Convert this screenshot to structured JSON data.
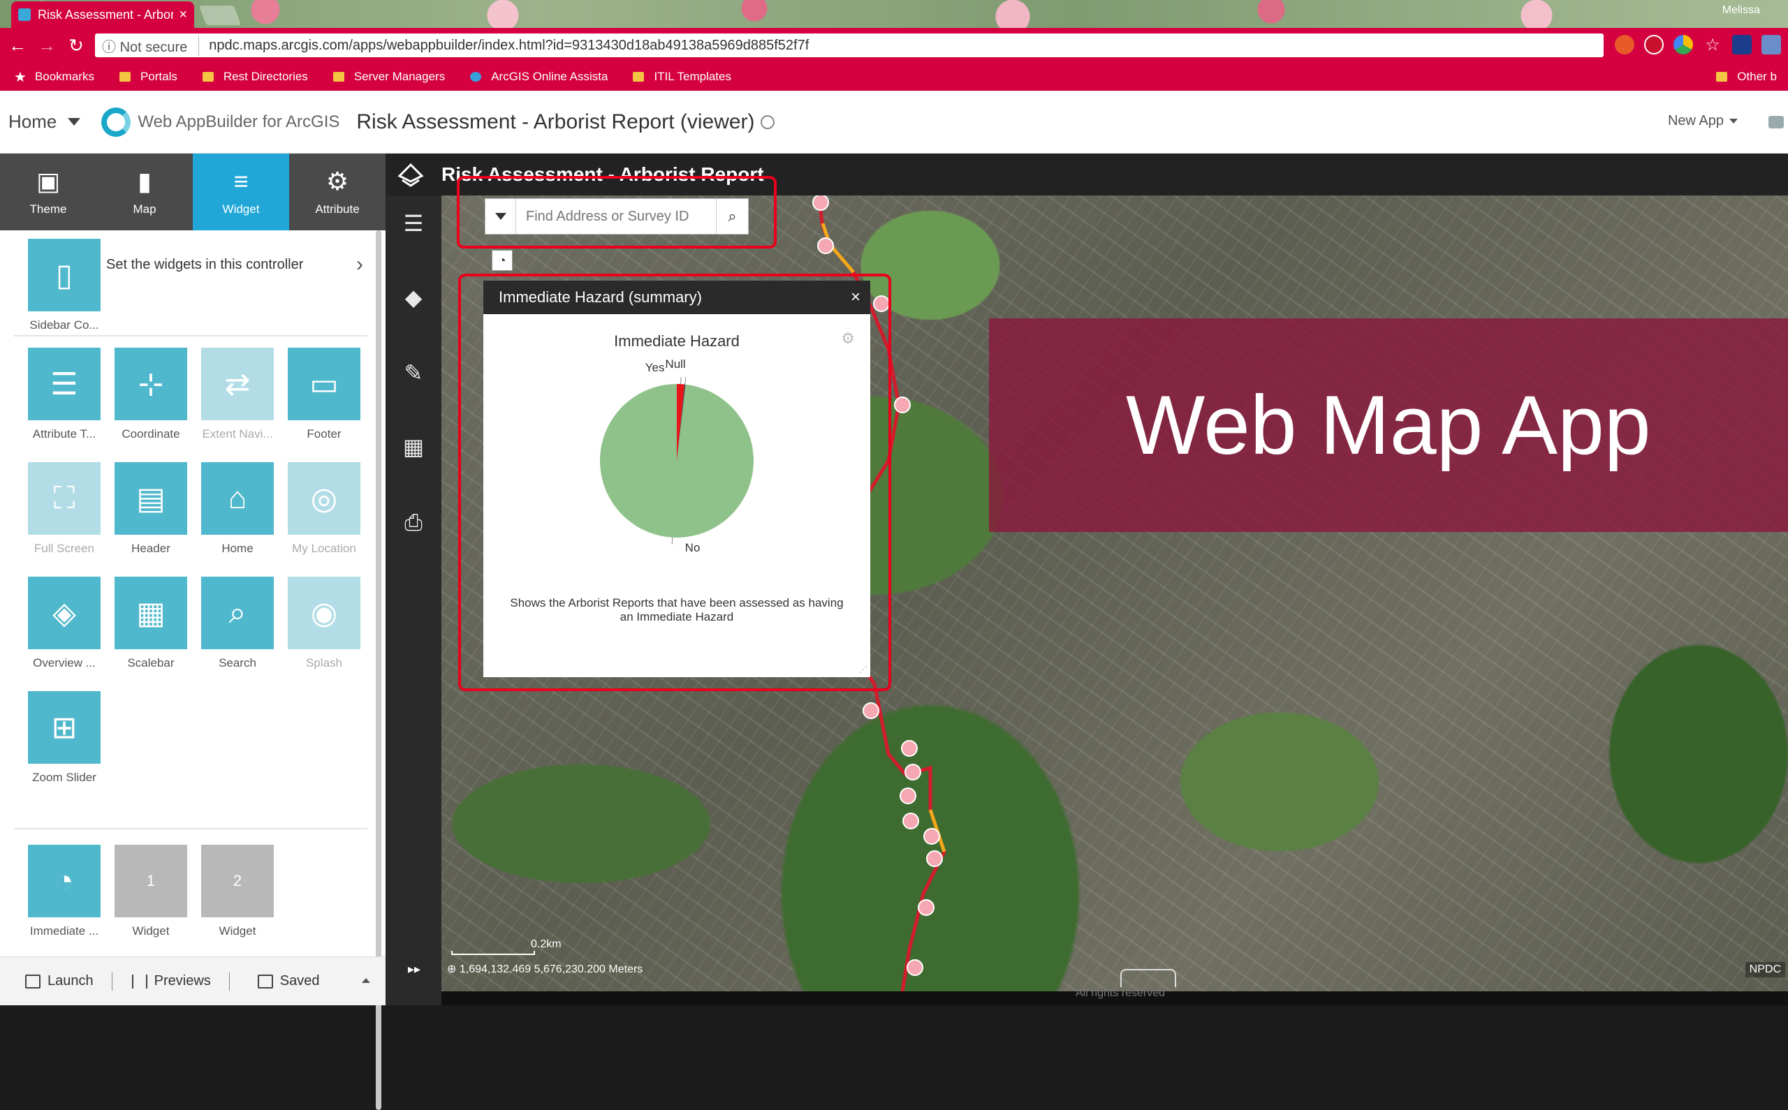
{
  "browser": {
    "tab_title": "Risk Assessment - Arbori",
    "tab_close": "×",
    "user": "Melissa",
    "secure_label": "Not secure",
    "url": "npdc.maps.arcgis.com/apps/webappbuilder/index.html?id=9313430d18ab49138a5969d885f52f7f",
    "bookmarks": [
      "Bookmarks",
      "Portals",
      "Rest Directories",
      "Server Managers",
      "ArcGIS Online Assista",
      "ITIL Templates"
    ],
    "other_bookmarks": "Other b"
  },
  "app_header": {
    "home": "Home",
    "product": "Web AppBuilder for ArcGIS",
    "title": "Risk Assessment - Arborist Report (viewer)",
    "new_app": "New App"
  },
  "modes": [
    {
      "label": "Theme",
      "icon": "▣"
    },
    {
      "label": "Map",
      "icon": "▮"
    },
    {
      "label": "Widget",
      "icon": "≡"
    },
    {
      "label": "Attribute",
      "icon": "⚙"
    }
  ],
  "sidebar_controller": {
    "label": "Sidebar Co...",
    "text": "Set the widgets in this controller",
    "chevron": "›"
  },
  "widgets": [
    {
      "label": "Attribute T...",
      "icon": "☰",
      "enabled": true
    },
    {
      "label": "Coordinate",
      "icon": "⊹",
      "enabled": true
    },
    {
      "label": "Extent Navi...",
      "icon": "⇄",
      "enabled": false
    },
    {
      "label": "Footer",
      "icon": "▭",
      "enabled": true
    },
    {
      "label": "Full Screen",
      "icon": "⛶",
      "enabled": false
    },
    {
      "label": "Header",
      "icon": "▤",
      "enabled": true
    },
    {
      "label": "Home",
      "icon": "⌂",
      "enabled": true
    },
    {
      "label": "My Location",
      "icon": "◎",
      "enabled": false
    },
    {
      "label": "Overview ...",
      "icon": "◈",
      "enabled": true
    },
    {
      "label": "Scalebar",
      "icon": "▦",
      "enabled": true
    },
    {
      "label": "Search",
      "icon": "⌕",
      "enabled": true
    },
    {
      "label": "Splash",
      "icon": "◉",
      "enabled": false
    },
    {
      "label": "Zoom Slider",
      "icon": "⊞",
      "enabled": true
    }
  ],
  "placeholders": [
    {
      "label": "Immediate ...",
      "icon": "◔",
      "slot": ""
    },
    {
      "label": "Widget",
      "icon": "",
      "slot": "1"
    },
    {
      "label": "Widget",
      "icon": "",
      "slot": "2"
    }
  ],
  "footer": {
    "launch": "Launch",
    "previews": "Previews",
    "saved": "Saved"
  },
  "map_app": {
    "title": "Risk Assessment - Arborist Report",
    "search_placeholder": "Find Address or Survey ID",
    "banner": "Web Map App",
    "coords": "1,694,132.469 5,676,230.200 Meters",
    "scale": "0.2km",
    "attribution": "NPDC",
    "rights": "All rights reserved"
  },
  "hazard_panel": {
    "title": "Immediate Hazard (summary)",
    "close": "×",
    "description": "Shows the Arborist Reports that have been assessed as having an Immediate Hazard"
  },
  "chart_data": {
    "type": "pie",
    "title": "Immediate Hazard",
    "slices": [
      {
        "label": "No",
        "value": 98.2,
        "color": "#8fc28a"
      },
      {
        "label": "Yes",
        "value": 1.6,
        "color": "#e8151b"
      },
      {
        "label": "Null",
        "value": 0.2,
        "color": "#3a3a3a"
      }
    ]
  }
}
